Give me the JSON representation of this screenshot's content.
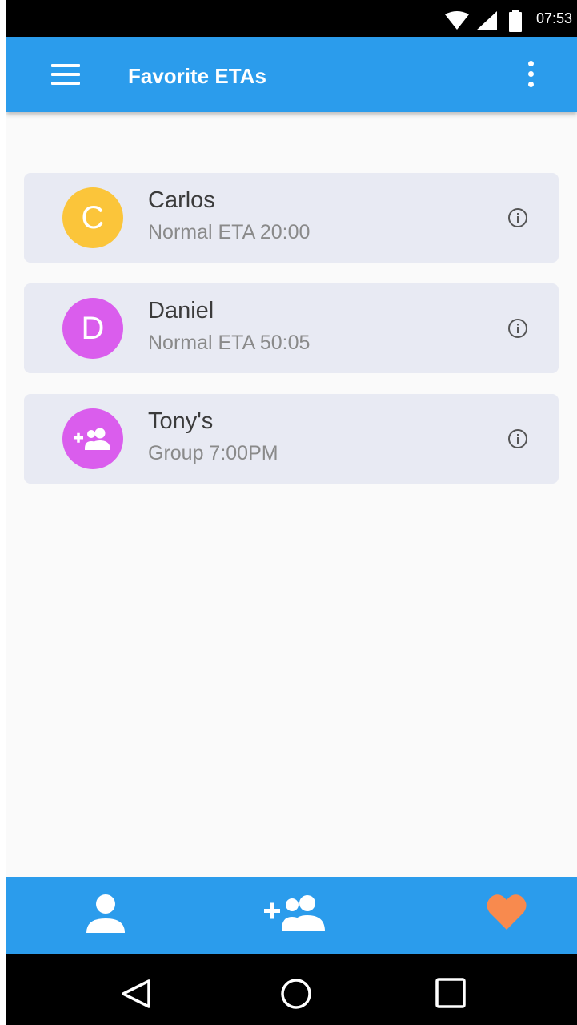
{
  "status_bar": {
    "time": "07:53",
    "icons": [
      "wifi-icon",
      "signal-icon",
      "battery-icon"
    ]
  },
  "app_bar": {
    "title": "Favorite ETAs",
    "menu_icon": "menu-icon",
    "more_icon": "more-vert-icon"
  },
  "favorites": [
    {
      "avatar_letter": "C",
      "avatar_color": "#fbc53a",
      "name": "Carlos",
      "detail": "Normal ETA 20:00"
    },
    {
      "avatar_letter": "D",
      "avatar_color": "#da5ded",
      "name": "Daniel",
      "detail": "Normal ETA 50:05"
    },
    {
      "avatar_icon": "group-add-icon",
      "avatar_color": "#da5ded",
      "name": "Tony's",
      "detail": "Group 7:00PM"
    }
  ],
  "bottom_nav": {
    "items": [
      {
        "icon": "person-icon",
        "color": "#ffffff"
      },
      {
        "icon": "group-add-icon",
        "color": "#ffffff"
      },
      {
        "icon": "heart-icon",
        "color": "#f88a4e"
      }
    ]
  },
  "system_nav": {
    "items": [
      "back-icon",
      "home-icon",
      "recents-icon"
    ]
  },
  "colors": {
    "primary": "#2b9cec",
    "card_bg": "#e8eaf3",
    "accent": "#f88a4e"
  }
}
